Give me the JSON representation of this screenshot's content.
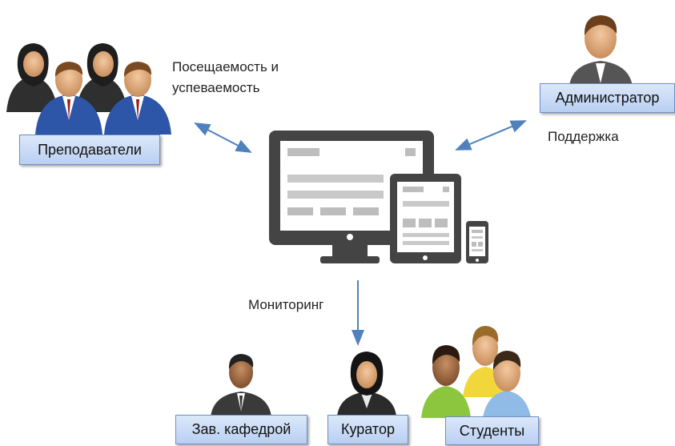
{
  "roles": {
    "teachers": "Преподаватели",
    "admin": "Администратор",
    "dept_head": "Зав. кафедрой",
    "curator": "Куратор",
    "students": "Студенты"
  },
  "captions": {
    "attendance_line1": "Посещаемость и",
    "attendance_line2": "успеваемость",
    "support": "Поддержка",
    "monitoring": "Мониторинг"
  },
  "icons": {
    "center": "responsive-devices-icon",
    "teachers": "teacher-group-icon",
    "admin": "administrator-icon",
    "dept_head": "department-head-icon",
    "curator": "curator-icon",
    "students": "students-group-icon"
  },
  "colors": {
    "arrow": "#4f81bd",
    "device": "#444444",
    "box_fill": "#c9daf5",
    "box_border": "#6f8fc4"
  }
}
